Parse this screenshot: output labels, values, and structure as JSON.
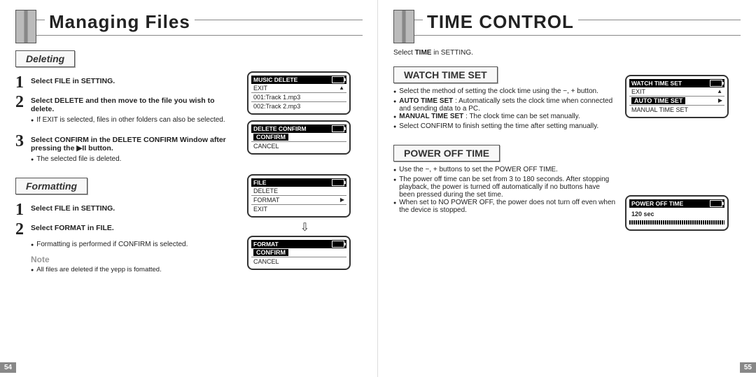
{
  "left": {
    "title": "Managing Files",
    "section1": "Deleting",
    "step1": "Select FILE in SETTING.",
    "step2": "Select DELETE and then move to the file you wish to delete.",
    "step2_bullet": "If EXIT is selected, files in other folders can also be selected.",
    "step3": "Select CONFIRM in the DELETE CONFIRM Window after pressing the ▶II button.",
    "step3_bullet": "The selected file is deleted.",
    "section2": "Formatting",
    "fmt_step1": "Select FILE in SETTING.",
    "fmt_step2": "Select FORMAT in FILE.",
    "fmt_bullet": "Formatting is performed if CONFIRM is selected.",
    "note_label": "Note",
    "note_text": "All files are deleted if the yepp is fomatted.",
    "page_num": "54",
    "lcd1": {
      "title": "MUSIC DELETE",
      "r1": "EXIT",
      "r2": "001:Track 1.mp3",
      "r3": "002:Track 2.mp3"
    },
    "lcd2": {
      "title": "DELETE CONFIRM",
      "r1": "CONFIRM",
      "r2": "CANCEL"
    },
    "lcd3": {
      "title": "FILE",
      "r1": "DELETE",
      "r2": "FORMAT",
      "r3": "EXIT"
    },
    "lcd4": {
      "title": "FORMAT",
      "r1": "CONFIRM",
      "r2": "CANCEL"
    }
  },
  "right": {
    "title": "TIME CONTROL",
    "intro": "Select TIME in SETTING.",
    "sectionA": "WATCH TIME SET",
    "a_b1": "Select the method of setting the clock time using the −, + button.",
    "a_b2a": "AUTO TIME SET",
    "a_b2b": ": Automatically sets the clock time when connected and sending data to a PC.",
    "a_b3a": "MANUAL TIME SET",
    "a_b3b": ": The clock time can be set manually.",
    "a_b4": "Select CONFIRM to finish setting the time after setting manually.",
    "sectionB": "POWER OFF TIME",
    "b_b1": "Use the −, + buttons to set the POWER OFF TIME.",
    "b_b2": "The power off time can be set from 3 to 180 seconds. After stopping playback, the power is turned off automatically if no buttons have been pressed during the set time.",
    "b_b3": "When set to NO POWER OFF, the power does not turn off even when the device is stopped.",
    "page_num": "55",
    "lcdA": {
      "title": "WATCH TIME SET",
      "r1": "EXIT",
      "r2": "AUTO TIME SET",
      "r3": "MANUAL TIME SET"
    },
    "lcdB": {
      "title": "POWER OFF TIME",
      "val": "120 sec"
    }
  }
}
